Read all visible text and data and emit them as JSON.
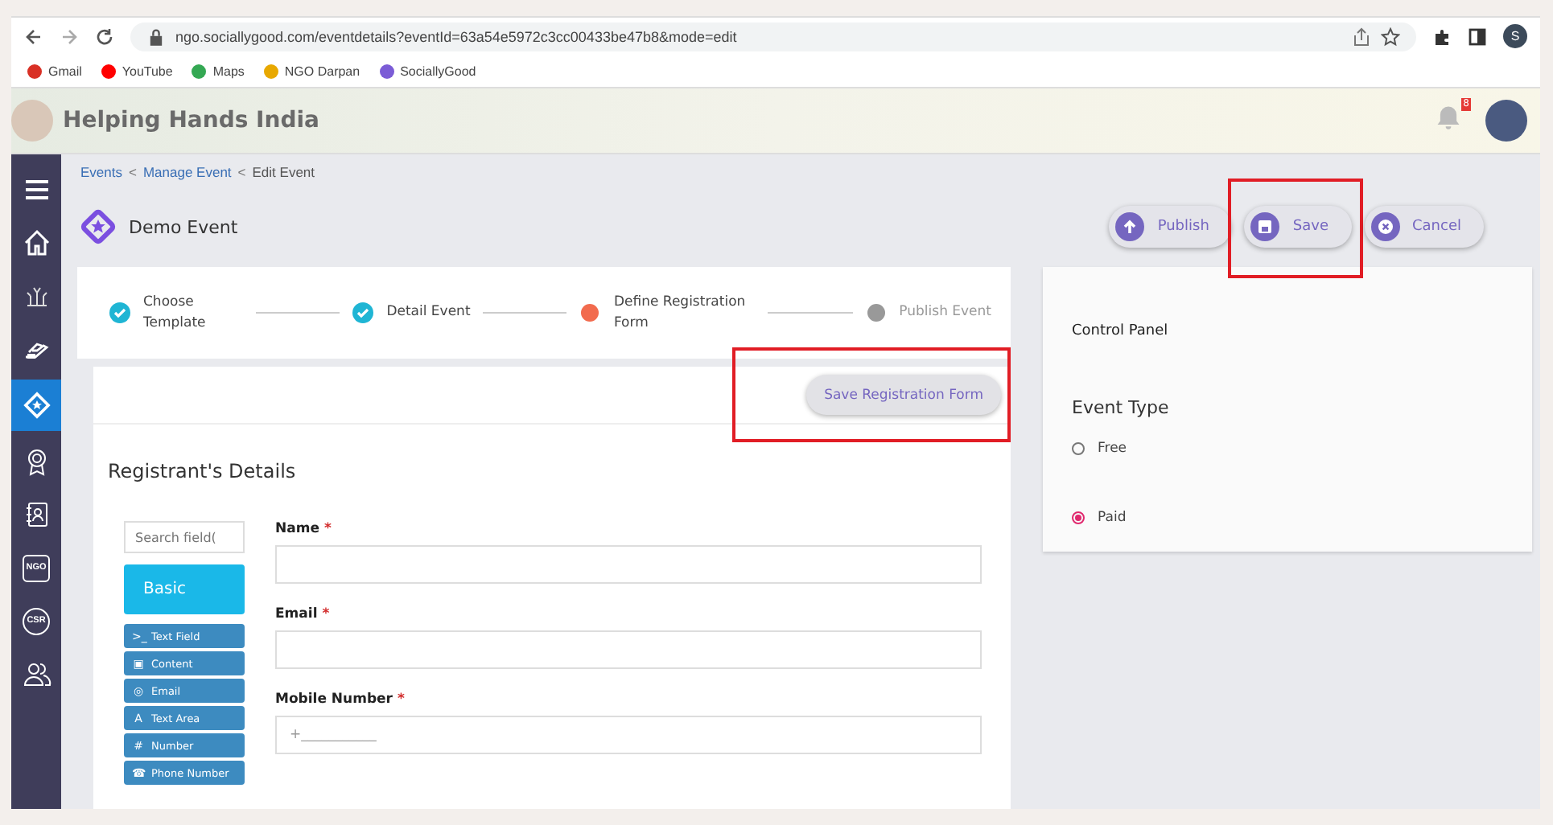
{
  "browser": {
    "url": "ngo.sociallygood.com/eventdetails?eventId=63a54e5972c3cc00433be47b8&mode=edit",
    "profile_initial": "S",
    "bookmarks": [
      {
        "label": "Gmail",
        "color": "#d93025"
      },
      {
        "label": "YouTube",
        "color": "#ff0000"
      },
      {
        "label": "Maps",
        "color": "#34a853"
      },
      {
        "label": "NGO Darpan",
        "color": "#e8a800"
      },
      {
        "label": "SociallyGood",
        "color": "#7b5cd6"
      }
    ]
  },
  "header": {
    "org_name": "Helping Hands India",
    "notification_count": "8"
  },
  "sidebar": {
    "items": [
      {
        "kind": "menu",
        "selected": false
      },
      {
        "kind": "home",
        "selected": false
      },
      {
        "kind": "plant",
        "selected": false
      },
      {
        "kind": "donate",
        "selected": false
      },
      {
        "kind": "event",
        "selected": true
      },
      {
        "kind": "award",
        "selected": false
      },
      {
        "kind": "contacts",
        "selected": false
      },
      {
        "kind": "ngo",
        "label": "NGO",
        "selected": false
      },
      {
        "kind": "csr",
        "label": "CSR",
        "selected": false
      },
      {
        "kind": "people",
        "selected": false
      }
    ]
  },
  "breadcrumb": [
    {
      "label": "Events",
      "link": true,
      "separator": "<"
    },
    {
      "label": "Manage Event",
      "link": true,
      "separator": "<"
    },
    {
      "label": "Edit Event",
      "link": false
    }
  ],
  "page_title": "Demo Event",
  "actions": [
    {
      "kind": "publish",
      "label": "Publish",
      "highlighted": false
    },
    {
      "kind": "save",
      "label": "Save",
      "highlighted": true
    },
    {
      "kind": "cancel",
      "label": "Cancel",
      "highlighted": false
    }
  ],
  "stepper": [
    {
      "label": "Choose Template",
      "completed": true,
      "active": false
    },
    {
      "label": "Detail Event",
      "completed": true,
      "active": false
    },
    {
      "label": "Define Registration Form",
      "completed": false,
      "active": true
    },
    {
      "label": "Publish Event",
      "completed": false,
      "active": false
    }
  ],
  "form_toolbar": {
    "button": "Save Registration Form",
    "highlighted": true
  },
  "section_title": "Registrant's Details",
  "palette": {
    "search_placeholder": "Search field(",
    "group": "Basic",
    "items": [
      {
        "icon": ">_",
        "label": "Text Field"
      },
      {
        "icon": "▣",
        "label": "Content"
      },
      {
        "icon": "◎",
        "label": "Email"
      },
      {
        "icon": "A",
        "label": "Text Area"
      },
      {
        "icon": "#",
        "label": "Number"
      },
      {
        "icon": "☎",
        "label": "Phone Number"
      }
    ]
  },
  "fields": [
    {
      "label": "Name",
      "required_mark": "*"
    },
    {
      "label": "Email",
      "required_mark": "*"
    },
    {
      "label": "Mobile Number",
      "required_mark": "*",
      "placeholder": "+___________"
    }
  ],
  "control_panel": {
    "title": "Control Panel",
    "event_type_label": "Event Type",
    "options": [
      {
        "label": "Free",
        "selected": false
      },
      {
        "label": "Paid",
        "selected": true
      }
    ]
  }
}
